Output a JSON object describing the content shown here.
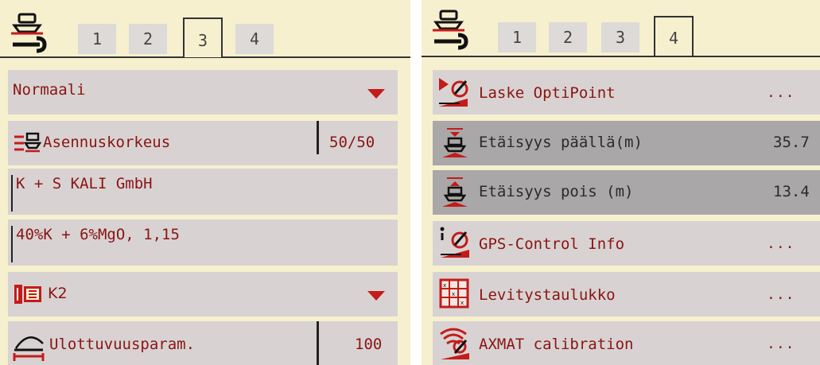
{
  "left_panel": {
    "tabs": [
      "1",
      "2",
      "3",
      "4"
    ],
    "active_tab": "3",
    "mode": {
      "value": "Normaali"
    },
    "install_height": {
      "label": "Asennuskorkeus",
      "value": "50/50"
    },
    "fertilizer_maker": {
      "value": "K + S KALI GmbH"
    },
    "fertilizer_name": {
      "value": "40%K + 6%MgO,   1,15"
    },
    "disc": {
      "value": "K2"
    },
    "throw_param": {
      "label": "Ulottuvuusparam.",
      "value": "100"
    }
  },
  "right_panel": {
    "tabs": [
      "1",
      "2",
      "3",
      "4"
    ],
    "active_tab": "4",
    "optipoint": {
      "label": "Laske OptiPoint",
      "more": "..."
    },
    "distance_on": {
      "label": "Etäisyys päällä(m)",
      "value": "35.7"
    },
    "distance_off": {
      "label": "Etäisyys pois (m)",
      "value": "13.4"
    },
    "gps_info": {
      "label": "GPS-Control Info",
      "more": "..."
    },
    "spread_table": {
      "label": "Levitystaulukko",
      "more": "..."
    },
    "axmat": {
      "label": "AXMAT calibration",
      "more": "..."
    }
  },
  "colors": {
    "panel_bg": "#f6f0cf",
    "row_bg": "#d8d3d2",
    "row_selected_bg": "#a9a7a7",
    "text_red": "#8a1414",
    "accent_red": "#c41b1b"
  }
}
